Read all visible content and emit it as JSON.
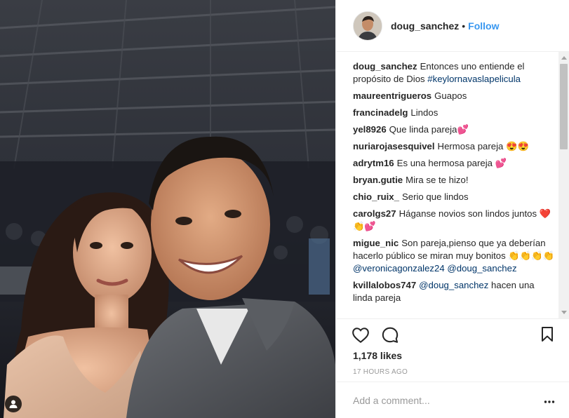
{
  "post": {
    "author": "doug_sanchez",
    "separator": "•",
    "follow_label": "Follow",
    "photo_alt": "Selfie of a smiling couple at an indoor event"
  },
  "comments": [
    {
      "user": "doug_sanchez",
      "text": "Entonces uno entiende el propósito de Dios ",
      "link": "#keylornavaslapelicula"
    },
    {
      "user": "maureentrigueros",
      "text": "Guapos"
    },
    {
      "user": "francinadelg",
      "text": "Lindos"
    },
    {
      "user": "yel8926",
      "text": "Que linda pareja💕"
    },
    {
      "user": "nuriarojasesquivel",
      "text": "Hermosa pareja 😍😍"
    },
    {
      "user": "adrytm16",
      "text": "Es una hermosa pareja 💕"
    },
    {
      "user": "bryan.gutie",
      "text": "Mira se te hizo!"
    },
    {
      "user": "chio_ruix_",
      "text": "Serio que lindos"
    },
    {
      "user": "carolgs27",
      "text": "Háganse novios son lindos juntos ❤️👏💕"
    },
    {
      "user": "migue_nic",
      "text": "Son pareja,pienso que ya deberían hacerlo público se miran muy bonitos 👏👏👏👏 ",
      "link": "@veronicagonzalez24",
      "link2": "@doug_sanchez"
    },
    {
      "user": "kvillalobos747",
      "text": " hacen una linda pareja",
      "lead_link": "@doug_sanchez"
    }
  ],
  "engagement": {
    "likes_label": "1,178 likes",
    "time_label": "17 HOURS AGO"
  },
  "comment_input": {
    "placeholder": "Add a comment..."
  },
  "icons": {
    "like": "heart-icon",
    "comment": "comment-bubble-icon",
    "save": "bookmark-icon",
    "options": "more-options-icon",
    "tags": "user-tag-icon"
  },
  "colors": {
    "link": "#003569",
    "follow": "#3897f0",
    "muted": "#999999",
    "text": "#262626"
  }
}
